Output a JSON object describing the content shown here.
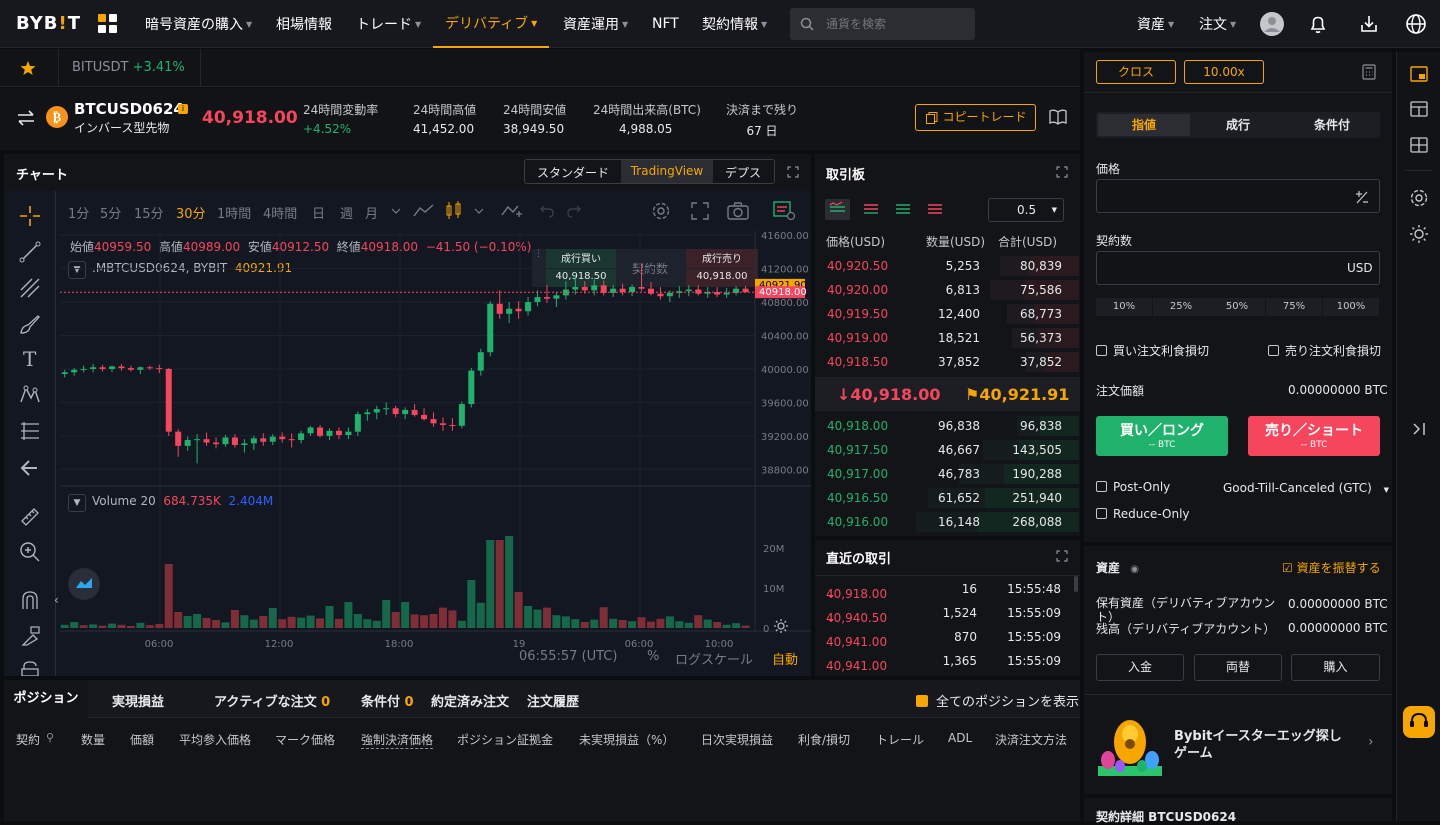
{
  "logo": {
    "text_a": "BYB",
    "text_b": "!",
    "text_c": "T"
  },
  "nav": {
    "items": [
      "暗号資産の購入",
      "相場情報",
      "トレード",
      "デリバティブ",
      "資産運用",
      "NFT",
      "契約情報"
    ],
    "search_placeholder": "通貨を検索",
    "assets": "資産",
    "orders": "注文"
  },
  "ticker": {
    "symbol": "BITUSDT",
    "change": "+3.41%"
  },
  "info": {
    "symbol": "BTCUSD0624",
    "subtitle": "インバース型先物",
    "price": "40,918.00",
    "stats": [
      {
        "label": "24時間変動率",
        "value": "+4.52%"
      },
      {
        "label": "24時間高値",
        "value": "41,452.00"
      },
      {
        "label": "24時間安値",
        "value": "38,949.50"
      },
      {
        "label": "24時間出来高(BTC)",
        "value": "4,988.05"
      },
      {
        "label": "決済まで残り",
        "value": "67 日"
      }
    ],
    "copy_trade": "コピートレード"
  },
  "chart": {
    "title": "チャート",
    "views": [
      "スタンダード",
      "TradingView",
      "デプス"
    ],
    "intervals": [
      "1分",
      "5分",
      "15分",
      "30分",
      "1時間",
      "4時間",
      "日",
      "週",
      "月"
    ],
    "ohlc": {
      "o_label": "始値",
      "o": "40959.50",
      "h_label": "高値",
      "h": "40989.00",
      "l_label": "安値",
      "l": "40912.50",
      "c_label": "終値",
      "c": "40918.00",
      "chg": "−41.50 (−0.10%)"
    },
    "series_name": ".MBTCUSD0624, BYBIT",
    "series_value": "40921.91",
    "buy_label": "成行買い",
    "buy_price": "40,918.50",
    "center_label": "契約数",
    "sell_label": "成行売り",
    "sell_price": "40,918.00",
    "price_axis": [
      "41600.00",
      "41200.00",
      "40800.00",
      "40400.00",
      "40000.00",
      "39600.00",
      "39200.00",
      "38800.00"
    ],
    "tag_a": "40921.90",
    "tag_b": "40918.00",
    "vol_label": "Volume 20",
    "vol_a": "684.735K",
    "vol_b": "2.404M",
    "vol_axis": [
      "20M",
      "10M",
      "0"
    ],
    "time_axis": [
      "06:00",
      "12:00",
      "18:00",
      "19",
      "06:00",
      "10:00"
    ],
    "clock": "06:55:57 (UTC)",
    "pct": "%",
    "log": "ログスケール",
    "auto": "自動"
  },
  "chart_data": {
    "type": "candlestick",
    "symbol": ".MBTCUSD0624",
    "y_range": [
      38600,
      41650
    ],
    "ohlc": [
      [
        39940,
        39990,
        39900,
        39960
      ],
      [
        39960,
        40010,
        39920,
        39990
      ],
      [
        39990,
        40040,
        39960,
        40000
      ],
      [
        40000,
        40060,
        39960,
        40020
      ],
      [
        40020,
        40050,
        39970,
        40000
      ],
      [
        40000,
        40040,
        39960,
        40030
      ],
      [
        40030,
        40060,
        39980,
        40010
      ],
      [
        40010,
        40040,
        39970,
        39990
      ],
      [
        39990,
        40030,
        39940,
        40020
      ],
      [
        40020,
        40040,
        39990,
        40010
      ],
      [
        40010,
        40050,
        39950,
        40000
      ],
      [
        40000,
        40010,
        39200,
        39250
      ],
      [
        39250,
        39280,
        38950,
        39080
      ],
      [
        39080,
        39190,
        39020,
        39150
      ],
      [
        39150,
        39220,
        38870,
        39160
      ],
      [
        39160,
        39240,
        39080,
        39120
      ],
      [
        39120,
        39180,
        39050,
        39100
      ],
      [
        39100,
        39210,
        39070,
        39180
      ],
      [
        39180,
        39220,
        39060,
        39090
      ],
      [
        39090,
        39160,
        39000,
        39110
      ],
      [
        39110,
        39200,
        39030,
        39170
      ],
      [
        39170,
        39230,
        39080,
        39130
      ],
      [
        39130,
        39220,
        39090,
        39190
      ],
      [
        39190,
        39240,
        39120,
        39160
      ],
      [
        39160,
        39230,
        39060,
        39150
      ],
      [
        39150,
        39260,
        39110,
        39230
      ],
      [
        39230,
        39320,
        39200,
        39300
      ],
      [
        39300,
        39330,
        39180,
        39200
      ],
      [
        39200,
        39290,
        39150,
        39260
      ],
      [
        39260,
        39300,
        39160,
        39210
      ],
      [
        39210,
        39300,
        39160,
        39250
      ],
      [
        39250,
        39490,
        39200,
        39460
      ],
      [
        39460,
        39520,
        39380,
        39480
      ],
      [
        39480,
        39560,
        39400,
        39520
      ],
      [
        39520,
        39600,
        39450,
        39530
      ],
      [
        39530,
        39560,
        39420,
        39460
      ],
      [
        39460,
        39540,
        39400,
        39510
      ],
      [
        39510,
        39580,
        39430,
        39450
      ],
      [
        39450,
        39530,
        39380,
        39400
      ],
      [
        39400,
        39480,
        39310,
        39350
      ],
      [
        39350,
        39420,
        39260,
        39330
      ],
      [
        39330,
        39410,
        39260,
        39320
      ],
      [
        39320,
        39610,
        39290,
        39580
      ],
      [
        39580,
        40010,
        39540,
        39980
      ],
      [
        39980,
        40240,
        39920,
        40200
      ],
      [
        40200,
        40810,
        40150,
        40780
      ],
      [
        40780,
        40940,
        40600,
        40660
      ],
      [
        40660,
        40800,
        40550,
        40720
      ],
      [
        40720,
        40810,
        40600,
        40690
      ],
      [
        40690,
        40860,
        40640,
        40800
      ],
      [
        40800,
        40940,
        40750,
        40860
      ],
      [
        40860,
        41000,
        40790,
        40840
      ],
      [
        40840,
        40920,
        40740,
        40880
      ],
      [
        40880,
        41050,
        40830,
        40950
      ],
      [
        40950,
        41120,
        40890,
        40980
      ],
      [
        40980,
        41050,
        40900,
        40940
      ],
      [
        40940,
        41070,
        40880,
        41000
      ],
      [
        41000,
        41060,
        40880,
        40910
      ],
      [
        40910,
        41000,
        40860,
        40960
      ],
      [
        40960,
        41020,
        40880,
        40920
      ],
      [
        40920,
        41010,
        40870,
        40980
      ],
      [
        40980,
        41250,
        40930,
        40960
      ],
      [
        40960,
        41040,
        40880,
        40900
      ],
      [
        40900,
        40980,
        40830,
        40870
      ],
      [
        40870,
        40940,
        40800,
        40910
      ],
      [
        40910,
        40990,
        40850,
        40930
      ],
      [
        40930,
        41000,
        40870,
        40950
      ],
      [
        40950,
        41000,
        40880,
        40900
      ],
      [
        40900,
        40980,
        40850,
        40920
      ],
      [
        40920,
        40980,
        40860,
        40890
      ],
      [
        40890,
        40970,
        40850,
        40910
      ],
      [
        40910,
        40990,
        40880,
        40960
      ],
      [
        40960,
        40990,
        40912,
        40918
      ]
    ],
    "volume_m": [
      0.8,
      1.5,
      0.7,
      0.9,
      0.6,
      1.1,
      0.8,
      0.5,
      1.3,
      0.7,
      1.0,
      16,
      4,
      3,
      3.5,
      2.5,
      2,
      1.4,
      4.5,
      3.2,
      2.1,
      3,
      5,
      2.2,
      2.8,
      2.6,
      3.1,
      2.4,
      5.5,
      2.3,
      6.5,
      3.5,
      2.2,
      1.8,
      7,
      4,
      6.5,
      3.4,
      3.2,
      3.5,
      5.1,
      4.4,
      1.8,
      12,
      6.3,
      22,
      22,
      23,
      9,
      5.5,
      4.6,
      5.1,
      3.2,
      2.9,
      2.2,
      1.5,
      2.1,
      5.2,
      2.3,
      2,
      1.7,
      2.7,
      1.6,
      2.3,
      2.9,
      1.7,
      1.3,
      3.2,
      2.1,
      1.5,
      0.8,
      1.2,
      0.6
    ],
    "volume_up": [
      1,
      1,
      0,
      1,
      0,
      1,
      0,
      0,
      1,
      0,
      0,
      0,
      0,
      1,
      1,
      0,
      0,
      1,
      0,
      1,
      1,
      0,
      1,
      0,
      0,
      1,
      1,
      0,
      1,
      0,
      1,
      1,
      1,
      1,
      1,
      0,
      1,
      0,
      0,
      0,
      0,
      0,
      1,
      1,
      1,
      1,
      0,
      1,
      0,
      1,
      1,
      0,
      1,
      1,
      1,
      0,
      1,
      0,
      1,
      0,
      1,
      0,
      0,
      0,
      1,
      1,
      1,
      0,
      1,
      0,
      1,
      1,
      0
    ]
  },
  "ob": {
    "title": "取引板",
    "step": "0.5",
    "headers": [
      "価格(USD)",
      "数量(USD)",
      "合計(USD)"
    ],
    "asks": [
      {
        "p": "40,920.50",
        "q": "5,253",
        "t": "80,839",
        "w": 33
      },
      {
        "p": "40,920.00",
        "q": "6,813",
        "t": "75,586",
        "w": 37
      },
      {
        "p": "40,919.50",
        "q": "12,400",
        "t": "68,773",
        "w": 30
      },
      {
        "p": "40,919.00",
        "q": "18,521",
        "t": "56,373",
        "w": 28
      },
      {
        "p": "40,918.50",
        "q": "37,852",
        "t": "37,852",
        "w": 22
      }
    ],
    "mid_price": "40,918.00",
    "mark_price": "40,921.91",
    "bids": [
      {
        "p": "40,918.00",
        "q": "96,838",
        "t": "96,838",
        "w": 26
      },
      {
        "p": "40,917.50",
        "q": "46,667",
        "t": "143,505",
        "w": 40
      },
      {
        "p": "40,917.00",
        "q": "46,783",
        "t": "190,288",
        "w": 50
      },
      {
        "p": "40,916.50",
        "q": "61,652",
        "t": "251,940",
        "w": 63
      },
      {
        "p": "40,916.00",
        "q": "16,148",
        "t": "268,088",
        "w": 68
      }
    ]
  },
  "trades": {
    "title": "直近の取引",
    "rows": [
      {
        "p": "40,918.00",
        "q": "16",
        "t": "15:55:48",
        "arrow": "↓"
      },
      {
        "p": "40,940.50",
        "q": "1,524",
        "t": "15:55:09",
        "arrow": "↓"
      },
      {
        "p": "40,941.00",
        "q": "870",
        "t": "15:55:09",
        "arrow": ""
      },
      {
        "p": "40,941.00",
        "q": "1,365",
        "t": "15:55:09",
        "arrow": ""
      }
    ]
  },
  "order": {
    "margin_mode": "クロス",
    "leverage": "10.00x",
    "tabs": [
      "指値",
      "成行",
      "条件付"
    ],
    "price_label": "価格",
    "qty_label": "契約数",
    "qty_unit": "USD",
    "pcts": [
      "10%",
      "25%",
      "50%",
      "75%",
      "100%"
    ],
    "tp_buy": "買い注文利食損切",
    "tp_sell": "売り注文利食損切",
    "value_label": "注文価額",
    "value": "0.00000000 BTC",
    "buy": "買い／ロング",
    "buy_sub": "-- BTC",
    "sell": "売り／ショート",
    "sell_sub": "-- BTC",
    "post_only": "Post-Only",
    "tif": "Good-Till-Canceled (GTC)",
    "reduce_only": "Reduce-Only"
  },
  "assets": {
    "title": "資産",
    "transfer": "資産を振替する",
    "held_label_a": "保有資産（デリバティブアカウン",
    "held_label_b": "ト）",
    "held": "0.00000000 BTC",
    "bal_label": "残高（デリバティブアカウント）",
    "bal": "0.00000000 BTC",
    "buttons": [
      "入金",
      "両替",
      "購入"
    ]
  },
  "promo": {
    "title": "Bybitイースターエッグ探しゲーム"
  },
  "details": {
    "title": "契約詳細 BTCUSD0624"
  },
  "positions": {
    "tabs": [
      "ポジション",
      "実現損益",
      "アクティブな注文",
      "条件付",
      "約定済み注文",
      "注文履歴"
    ],
    "active_count": "0",
    "cond_count": "0",
    "show_all": "全てのポジションを表示",
    "cols": [
      "契約",
      "数量",
      "価額",
      "平均参入価格",
      "マーク価格",
      "強制決済価格",
      "ポジション証拠金",
      "未実現損益（%）",
      "日次実現損益",
      "利食/損切",
      "トレール",
      "ADL",
      "決済注文方法"
    ]
  },
  "colors": {
    "up": "#20b26c",
    "down": "#f6465d",
    "accent": "#f7a600"
  }
}
